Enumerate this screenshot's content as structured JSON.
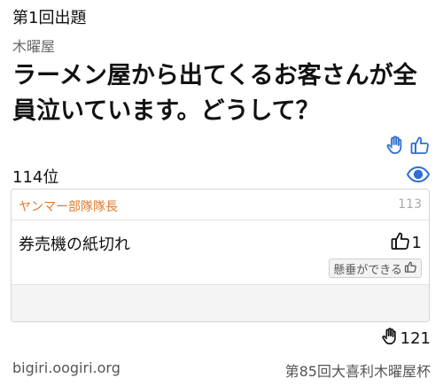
{
  "header": {
    "round": "第1回出題",
    "setter": "木曜屋",
    "question": "ラーメン屋から出てくるお客さんが全員泣いています。どうして？"
  },
  "status": {
    "rank": "114位"
  },
  "answer": {
    "author": "ヤンマー部隊隊長",
    "number": "113",
    "text": "券売機の紙切れ",
    "likes": "1",
    "tsukkomi_label": "懸垂ができる"
  },
  "footer": {
    "hand_count": "121",
    "site": "bigiri.oogiri.org",
    "cup": "第85回大喜利木曜屋杯"
  },
  "colors": {
    "accent_blue": "#2d6fd6",
    "author_orange": "#e07a2f"
  },
  "icons": [
    "raised-hand-icon",
    "thumbs-up-icon",
    "eye-icon",
    "thumbs-up-outline-icon",
    "hand-outline-icon"
  ]
}
